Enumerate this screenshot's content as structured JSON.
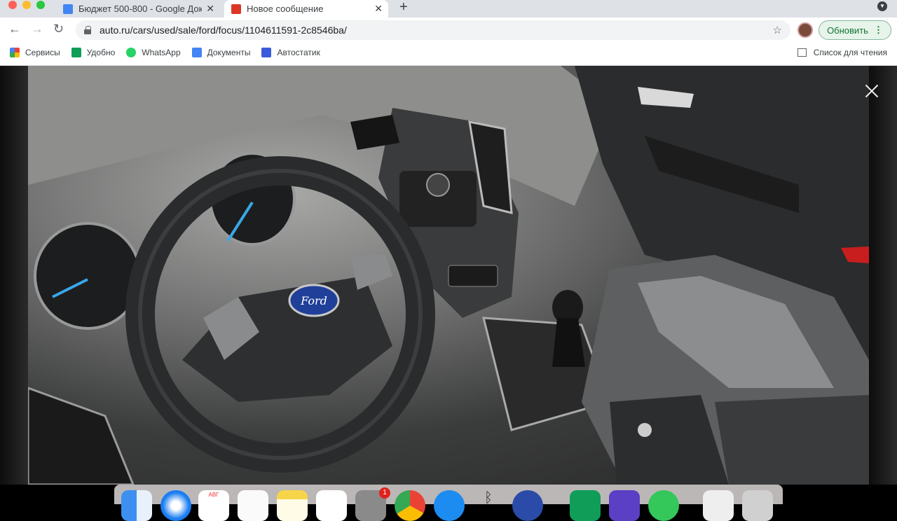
{
  "tabs": [
    {
      "title": "Бюджет 500-800 - Google Док",
      "favicon": "google-docs-icon",
      "color": "#4285f4"
    },
    {
      "title": "Новое сообщение",
      "favicon": "auto-ru-icon",
      "color": "#db3727"
    }
  ],
  "address_bar": {
    "url": "auto.ru/cars/used/sale/ford/focus/1104611591-2c8546ba/"
  },
  "update_button": {
    "label": "Обновить"
  },
  "bookmarks": [
    {
      "label": "Сервисы",
      "icon": "apps-grid-icon"
    },
    {
      "label": "Удобно",
      "icon": "google-sheets-icon"
    },
    {
      "label": "WhatsApp",
      "icon": "whatsapp-icon"
    },
    {
      "label": "Документы",
      "icon": "google-docs-icon"
    },
    {
      "label": "Автостатик",
      "icon": "car-icon"
    }
  ],
  "reading_list": {
    "label": "Список для чтения"
  },
  "photo": {
    "brand_badge": "Ford"
  },
  "dock": {
    "apps": [
      "finder",
      "safari",
      "calendar",
      "reminders",
      "notes",
      "music",
      "system-preferences",
      "chrome",
      "app-store",
      "bluetooth",
      "screen",
      "sheets",
      "imovie",
      "utorrent",
      "excel",
      "trash"
    ],
    "calendar_month": "АВГ",
    "settings_badge": "1"
  }
}
